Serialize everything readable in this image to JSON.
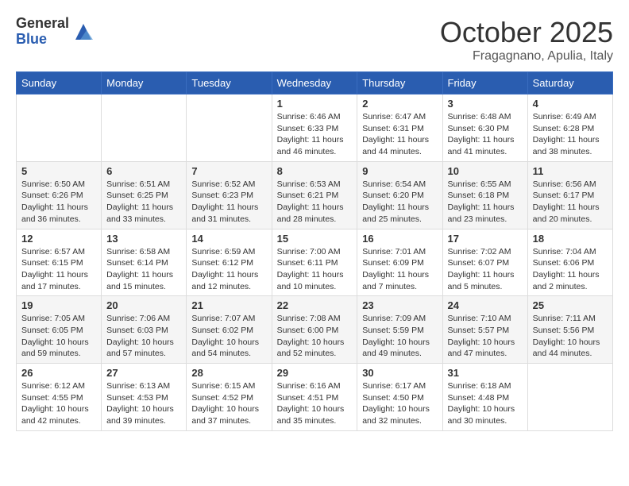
{
  "header": {
    "logo_general": "General",
    "logo_blue": "Blue",
    "month_title": "October 2025",
    "location": "Fragagnano, Apulia, Italy"
  },
  "weekdays": [
    "Sunday",
    "Monday",
    "Tuesday",
    "Wednesday",
    "Thursday",
    "Friday",
    "Saturday"
  ],
  "weeks": [
    [
      {
        "day": "",
        "info": ""
      },
      {
        "day": "",
        "info": ""
      },
      {
        "day": "",
        "info": ""
      },
      {
        "day": "1",
        "info": "Sunrise: 6:46 AM\nSunset: 6:33 PM\nDaylight: 11 hours and 46 minutes."
      },
      {
        "day": "2",
        "info": "Sunrise: 6:47 AM\nSunset: 6:31 PM\nDaylight: 11 hours and 44 minutes."
      },
      {
        "day": "3",
        "info": "Sunrise: 6:48 AM\nSunset: 6:30 PM\nDaylight: 11 hours and 41 minutes."
      },
      {
        "day": "4",
        "info": "Sunrise: 6:49 AM\nSunset: 6:28 PM\nDaylight: 11 hours and 38 minutes."
      }
    ],
    [
      {
        "day": "5",
        "info": "Sunrise: 6:50 AM\nSunset: 6:26 PM\nDaylight: 11 hours and 36 minutes."
      },
      {
        "day": "6",
        "info": "Sunrise: 6:51 AM\nSunset: 6:25 PM\nDaylight: 11 hours and 33 minutes."
      },
      {
        "day": "7",
        "info": "Sunrise: 6:52 AM\nSunset: 6:23 PM\nDaylight: 11 hours and 31 minutes."
      },
      {
        "day": "8",
        "info": "Sunrise: 6:53 AM\nSunset: 6:21 PM\nDaylight: 11 hours and 28 minutes."
      },
      {
        "day": "9",
        "info": "Sunrise: 6:54 AM\nSunset: 6:20 PM\nDaylight: 11 hours and 25 minutes."
      },
      {
        "day": "10",
        "info": "Sunrise: 6:55 AM\nSunset: 6:18 PM\nDaylight: 11 hours and 23 minutes."
      },
      {
        "day": "11",
        "info": "Sunrise: 6:56 AM\nSunset: 6:17 PM\nDaylight: 11 hours and 20 minutes."
      }
    ],
    [
      {
        "day": "12",
        "info": "Sunrise: 6:57 AM\nSunset: 6:15 PM\nDaylight: 11 hours and 17 minutes."
      },
      {
        "day": "13",
        "info": "Sunrise: 6:58 AM\nSunset: 6:14 PM\nDaylight: 11 hours and 15 minutes."
      },
      {
        "day": "14",
        "info": "Sunrise: 6:59 AM\nSunset: 6:12 PM\nDaylight: 11 hours and 12 minutes."
      },
      {
        "day": "15",
        "info": "Sunrise: 7:00 AM\nSunset: 6:11 PM\nDaylight: 11 hours and 10 minutes."
      },
      {
        "day": "16",
        "info": "Sunrise: 7:01 AM\nSunset: 6:09 PM\nDaylight: 11 hours and 7 minutes."
      },
      {
        "day": "17",
        "info": "Sunrise: 7:02 AM\nSunset: 6:07 PM\nDaylight: 11 hours and 5 minutes."
      },
      {
        "day": "18",
        "info": "Sunrise: 7:04 AM\nSunset: 6:06 PM\nDaylight: 11 hours and 2 minutes."
      }
    ],
    [
      {
        "day": "19",
        "info": "Sunrise: 7:05 AM\nSunset: 6:05 PM\nDaylight: 10 hours and 59 minutes."
      },
      {
        "day": "20",
        "info": "Sunrise: 7:06 AM\nSunset: 6:03 PM\nDaylight: 10 hours and 57 minutes."
      },
      {
        "day": "21",
        "info": "Sunrise: 7:07 AM\nSunset: 6:02 PM\nDaylight: 10 hours and 54 minutes."
      },
      {
        "day": "22",
        "info": "Sunrise: 7:08 AM\nSunset: 6:00 PM\nDaylight: 10 hours and 52 minutes."
      },
      {
        "day": "23",
        "info": "Sunrise: 7:09 AM\nSunset: 5:59 PM\nDaylight: 10 hours and 49 minutes."
      },
      {
        "day": "24",
        "info": "Sunrise: 7:10 AM\nSunset: 5:57 PM\nDaylight: 10 hours and 47 minutes."
      },
      {
        "day": "25",
        "info": "Sunrise: 7:11 AM\nSunset: 5:56 PM\nDaylight: 10 hours and 44 minutes."
      }
    ],
    [
      {
        "day": "26",
        "info": "Sunrise: 6:12 AM\nSunset: 4:55 PM\nDaylight: 10 hours and 42 minutes."
      },
      {
        "day": "27",
        "info": "Sunrise: 6:13 AM\nSunset: 4:53 PM\nDaylight: 10 hours and 39 minutes."
      },
      {
        "day": "28",
        "info": "Sunrise: 6:15 AM\nSunset: 4:52 PM\nDaylight: 10 hours and 37 minutes."
      },
      {
        "day": "29",
        "info": "Sunrise: 6:16 AM\nSunset: 4:51 PM\nDaylight: 10 hours and 35 minutes."
      },
      {
        "day": "30",
        "info": "Sunrise: 6:17 AM\nSunset: 4:50 PM\nDaylight: 10 hours and 32 minutes."
      },
      {
        "day": "31",
        "info": "Sunrise: 6:18 AM\nSunset: 4:48 PM\nDaylight: 10 hours and 30 minutes."
      },
      {
        "day": "",
        "info": ""
      }
    ]
  ]
}
